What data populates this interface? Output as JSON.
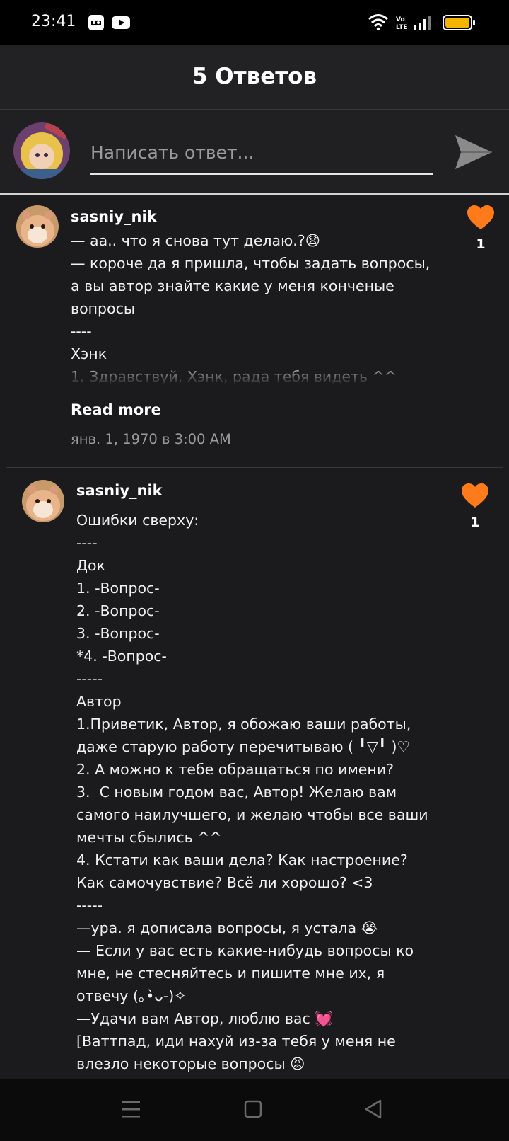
{
  "status_bar": {
    "time": "23:41",
    "icons": [
      "app-icon",
      "youtube-icon",
      "wifi-icon",
      "volte-icon",
      "signal-icon",
      "battery-icon"
    ]
  },
  "header": {
    "title": "5 Ответов"
  },
  "reply": {
    "placeholder": "Написать ответ...",
    "send_icon": "send-icon"
  },
  "comments": [
    {
      "username": "sasniy_nik",
      "text": "— аа.. что я снова тут делаю.?😧\n— короче да я пришла, чтобы задать вопросы,\nа вы автор знайте какие у меня конченые\nвопросы\n----\nХэнк\n1. Здравствуй, Хэнк, рада тебя видеть ^^",
      "likes": "1",
      "read_more": "Read more",
      "date": "янв. 1, 1970 в 3:00 AM"
    },
    {
      "username": "sasniy_nik",
      "text": "Ошибки сверху:\n----\nДок\n1. -Вопрос-\n2. -Вопрос-\n3. -Вопрос-\n*4. -Вопрос-\n-----\nАвтор\n1.Приветик, Автор, я обожаю ваши работы,\nдаже старую работу перечитываю ( ╹▽╹ )♡\n2. А можно к тебе обращаться по имени?\n3.  С новым годом вас, Автор! Желаю вам\nсамого наилучшего, и желаю чтобы все ваши\nмечты сбылись ^^\n4. Кстати как ваши дела? Как настроение?\nКак самочувствие? Всё ли хорошо? <3\n-----\n—ура. я дописала вопросы, я устала 😭\n— Если у вас есть какие-нибудь вопросы ко\nмне, не стесняйтесь и пишите мне их, я\nотвечу (｡•̀ᴗ-)✧\n—Удачи вам Автор, люблю вас 💓\n[Ваттпад, иди нахуй из-за тебя у меня не\nвлезло некоторые вопросы 😡",
      "likes": "1"
    }
  ],
  "colors": {
    "like": "#ff7a1a",
    "background": "#1b1a1d",
    "header": "#222124"
  },
  "nav_bar": {
    "icons": [
      "menu-icon",
      "home-icon",
      "back-icon"
    ]
  }
}
